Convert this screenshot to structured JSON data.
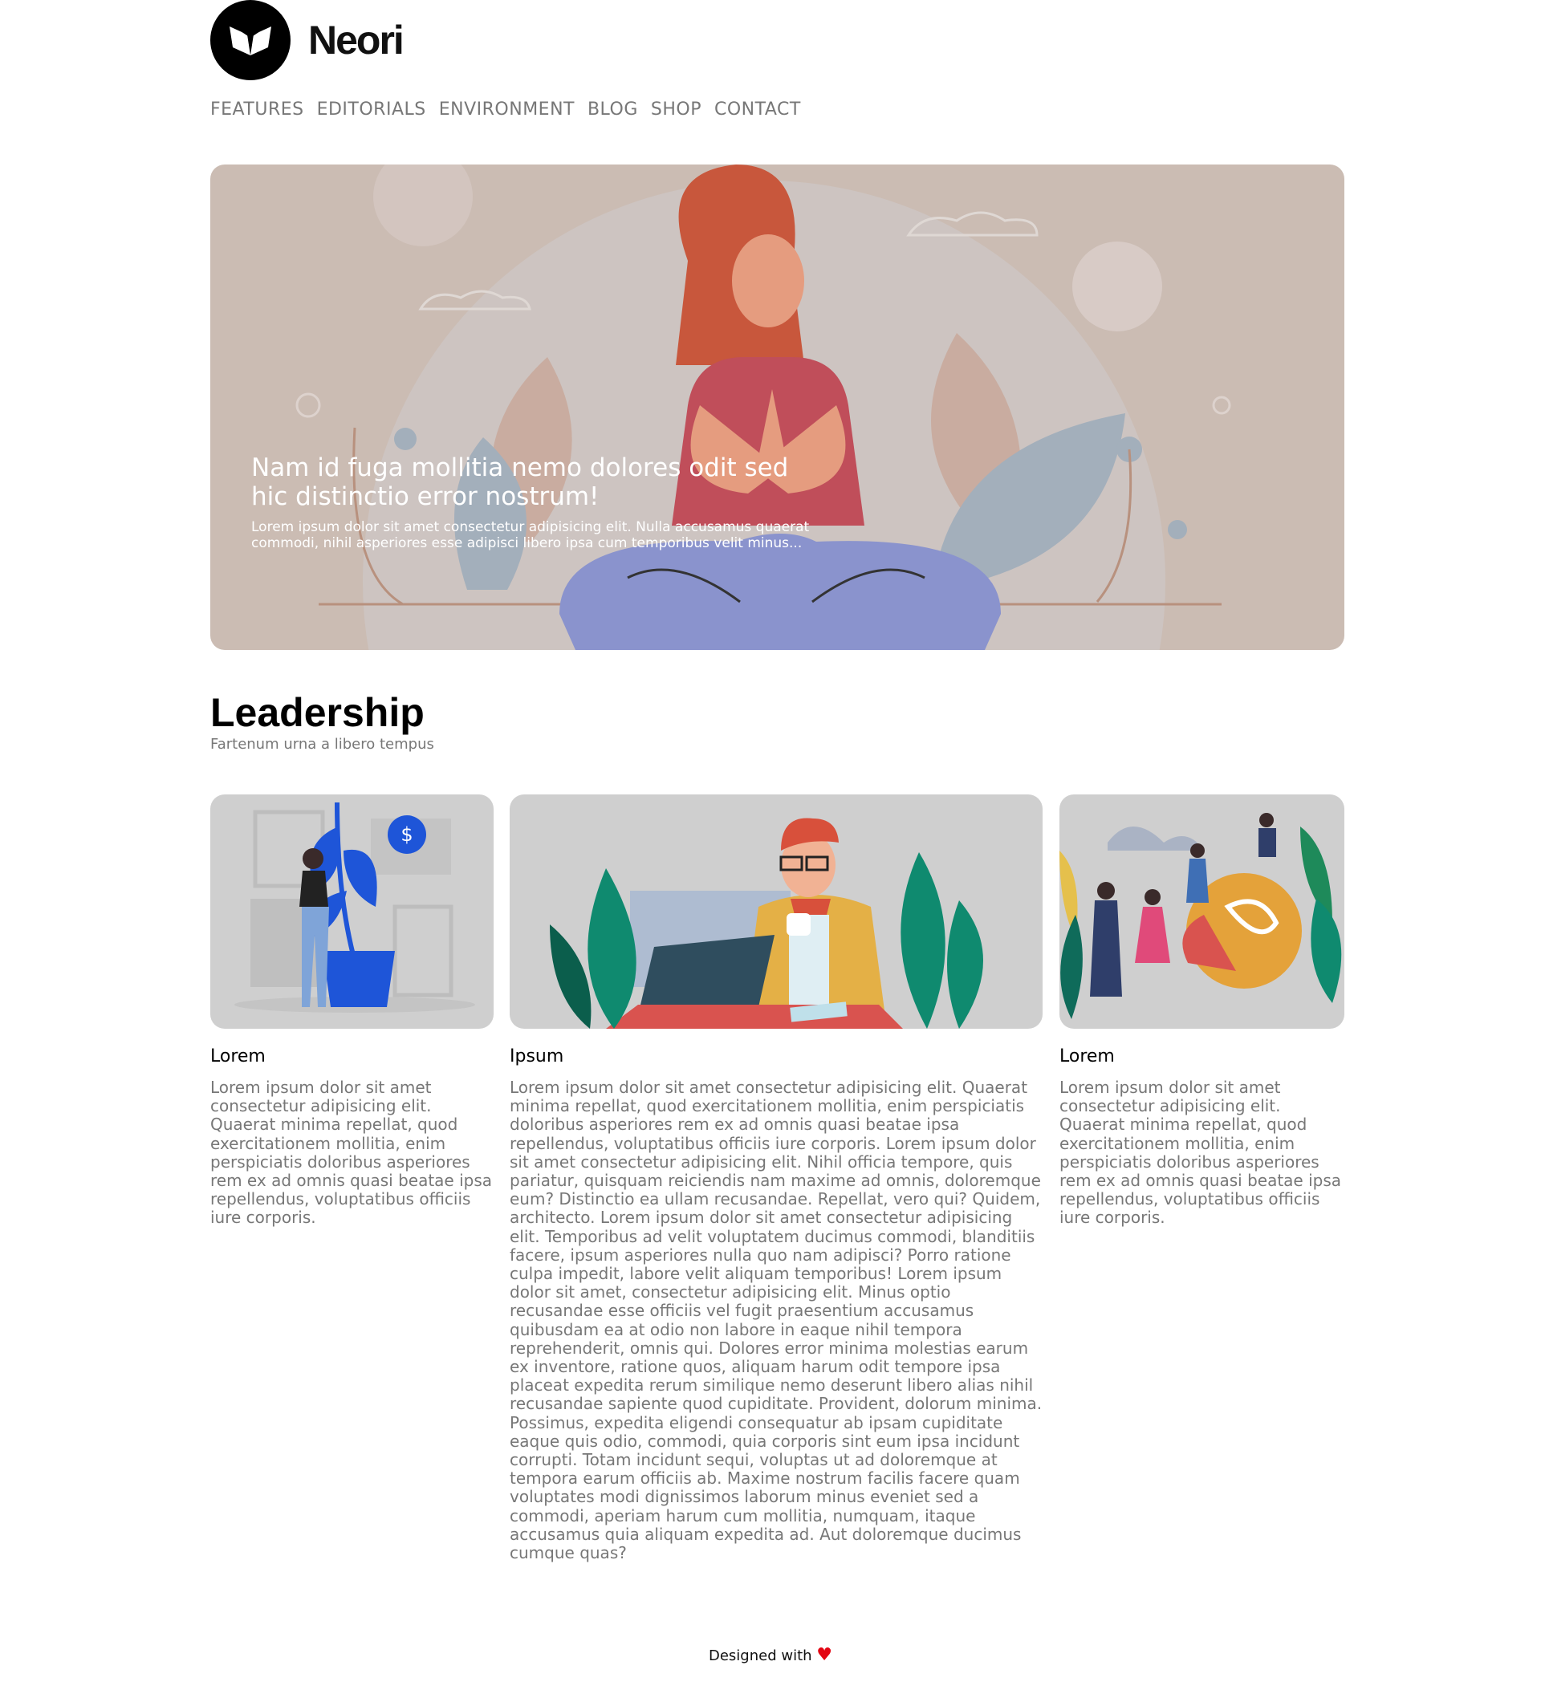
{
  "brand": {
    "name": "Neori"
  },
  "nav": [
    "FEATURES",
    "EDITORIALS",
    "ENVIRONMENT",
    "BLOG",
    "SHOP",
    "CONTACT"
  ],
  "hero": {
    "title": "Nam id fuga mollitia nemo dolores odit sed hic distinctio error nostrum!",
    "text": "Lorem ipsum dolor sit amet consectetur adipisicing elit. Nulla accusamus quaerat commodi, nihil asperiores esse adipisci libero ipsa cum temporibus velit minus..."
  },
  "section": {
    "title": "Leadership",
    "subtitle": "Fartenum urna a libero tempus"
  },
  "cards": [
    {
      "title": "Lorem",
      "text": "Lorem ipsum dolor sit amet consectetur adipisicing elit. Quaerat minima repellat, quod exercitationem mollitia, enim perspiciatis doloribus asperiores rem ex ad omnis quasi beatae ipsa repellendus, voluptatibus officiis iure corporis."
    },
    {
      "title": "Ipsum",
      "text": "Lorem ipsum dolor sit amet consectetur adipisicing elit. Quaerat minima repellat, quod exercitationem mollitia, enim perspiciatis doloribus asperiores rem ex ad omnis quasi beatae ipsa repellendus, voluptatibus officiis iure corporis. Lorem ipsum dolor sit amet consectetur adipisicing elit. Nihil officia tempore, quis pariatur, quisquam reiciendis nam maxime ad omnis, doloremque eum? Distinctio ea ullam recusandae. Repellat, vero qui? Quidem, architecto. Lorem ipsum dolor sit amet consectetur adipisicing elit. Temporibus ad velit voluptatem ducimus commodi, blanditiis facere, ipsum asperiores nulla quo nam adipisci? Porro ratione culpa impedit, labore velit aliquam temporibus! Lorem ipsum dolor sit amet, consectetur adipisicing elit. Minus optio recusandae esse officiis vel fugit praesentium accusamus quibusdam ea at odio non labore in eaque nihil tempora reprehenderit, omnis qui. Dolores error minima molestias earum ex inventore, ratione quos, aliquam harum odit tempore ipsa placeat expedita rerum similique nemo deserunt libero alias nihil recusandae sapiente quod cupiditate. Provident, dolorum minima. Possimus, expedita eligendi consequatur ab ipsam cupiditate eaque quis odio, commodi, quia corporis sint eum ipsa incidunt corrupti. Totam incidunt sequi, voluptas ut ad doloremque at tempora earum officiis ab. Maxime nostrum facilis facere quam voluptates modi dignissimos laborum minus eveniet sed a commodi, aperiam harum cum mollitia, numquam, itaque accusamus quia aliquam expedita ad. Aut doloremque ducimus cumque quas?"
    },
    {
      "title": "Lorem",
      "text": "Lorem ipsum dolor sit amet consectetur adipisicing elit. Quaerat minima repellat, quod exercitationem mollitia, enim perspiciatis doloribus asperiores rem ex ad omnis quasi beatae ipsa repellendus, voluptatibus officiis iure corporis."
    }
  ],
  "footer": {
    "text": "Designed with",
    "heart": "♥"
  },
  "colors": {
    "hero_bg": "#cbbcb3",
    "muted_text": "#777777",
    "heart": "#e30613"
  }
}
